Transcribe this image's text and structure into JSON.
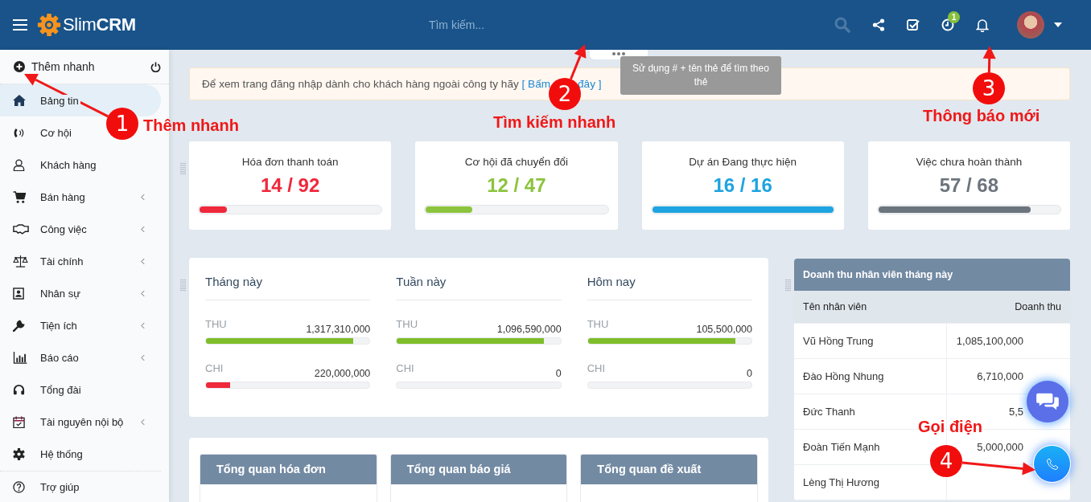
{
  "header": {
    "logo_light": "Slim",
    "logo_bold": "CRM",
    "search": {
      "placeholder": "Tìm kiếm..."
    },
    "search_tip": "Sử dụng # + tên thẻ để tìm theo thẻ",
    "reminder_badge": "1"
  },
  "sidebar": {
    "quick_add": "Thêm nhanh",
    "items": [
      {
        "label": "Bảng tin",
        "selected": true,
        "has_submenu": false
      },
      {
        "label": "Cơ hội",
        "selected": false,
        "has_submenu": false
      },
      {
        "label": "Khách hàng",
        "selected": false,
        "has_submenu": false
      },
      {
        "label": "Bán hàng",
        "selected": false,
        "has_submenu": true
      },
      {
        "label": "Công việc",
        "selected": false,
        "has_submenu": true
      },
      {
        "label": "Tài chính",
        "selected": false,
        "has_submenu": true
      },
      {
        "label": "Nhân sự",
        "selected": false,
        "has_submenu": true
      },
      {
        "label": "Tiện ích",
        "selected": false,
        "has_submenu": true
      },
      {
        "label": "Báo cáo",
        "selected": false,
        "has_submenu": true
      },
      {
        "label": "Tổng đài",
        "selected": false,
        "has_submenu": false
      },
      {
        "label": "Tài nguyên nội bộ",
        "selected": false,
        "has_submenu": true
      },
      {
        "label": "Hệ thống",
        "selected": false,
        "has_submenu": false
      }
    ],
    "help": "Trợ giúp"
  },
  "banner": {
    "text": "Để xem trang đăng nhập dành cho khách hàng ngoài công ty hãy",
    "link_start": "[ Bấm",
    "link_end": "đây ]"
  },
  "stats": [
    {
      "title": "Hóa đơn thanh toán",
      "value": "14 / 92",
      "level": 0.15,
      "color": "#f0283c"
    },
    {
      "title": "Cơ hội đã chuyển đổi",
      "value": "12 / 47",
      "level": 0.255,
      "color": "#8cc43e"
    },
    {
      "title": "Dự án Đang thực hiện",
      "value": "16 / 16",
      "level": 1,
      "color": "#1ea4e0"
    },
    {
      "title": "Việc chưa hoàn thành",
      "value": "57 / 68",
      "level": 0.84,
      "color": "#6c757d"
    }
  ],
  "finance": [
    {
      "period": "Tháng này",
      "rows": [
        {
          "label": "THU",
          "amount": "1,317,310,000",
          "level": 0.9,
          "color": "#7fbd2b"
        },
        {
          "label": "CHI",
          "amount": "220,000,000",
          "level": 0.15,
          "color": "#f0283c"
        }
      ]
    },
    {
      "period": "Tuần này",
      "rows": [
        {
          "label": "THU",
          "amount": "1,096,590,000",
          "level": 0.9,
          "color": "#7fbd2b"
        },
        {
          "label": "CHI",
          "amount": "0"
        }
      ]
    },
    {
      "period": "Hôm nay",
      "rows": [
        {
          "label": "THU",
          "amount": "105,500,000",
          "level": 0.9,
          "color": "#7fbd2b"
        },
        {
          "label": "CHI",
          "amount": "0"
        }
      ]
    }
  ],
  "overview": [
    {
      "title": "Tổng quan hóa đơn"
    },
    {
      "title": "Tổng quan báo giá"
    },
    {
      "title": "Tổng quan đề xuất"
    }
  ],
  "revenue_table": {
    "title": "Doanh thu nhân viên tháng này",
    "columns": [
      "Tên nhân viên",
      "Doanh thu"
    ],
    "rows": [
      [
        "Vũ Hồng Trung",
        "1,085,100,000"
      ],
      [
        "Đào Hồng Nhung",
        "6,710,000"
      ],
      [
        "Đức Thanh",
        "5,5"
      ],
      [
        "Đoàn Tiến Mạnh",
        "5,000,000"
      ],
      [
        "Lèng Thị Hương"
      ]
    ]
  },
  "annotations": [
    {
      "number": "1",
      "label": "Thêm nhanh"
    },
    {
      "number": "2",
      "label": "Tìm kiếm nhanh"
    },
    {
      "number": "3",
      "label": "Thông báo mới"
    },
    {
      "number": "4",
      "label": "Gọi điện"
    }
  ]
}
